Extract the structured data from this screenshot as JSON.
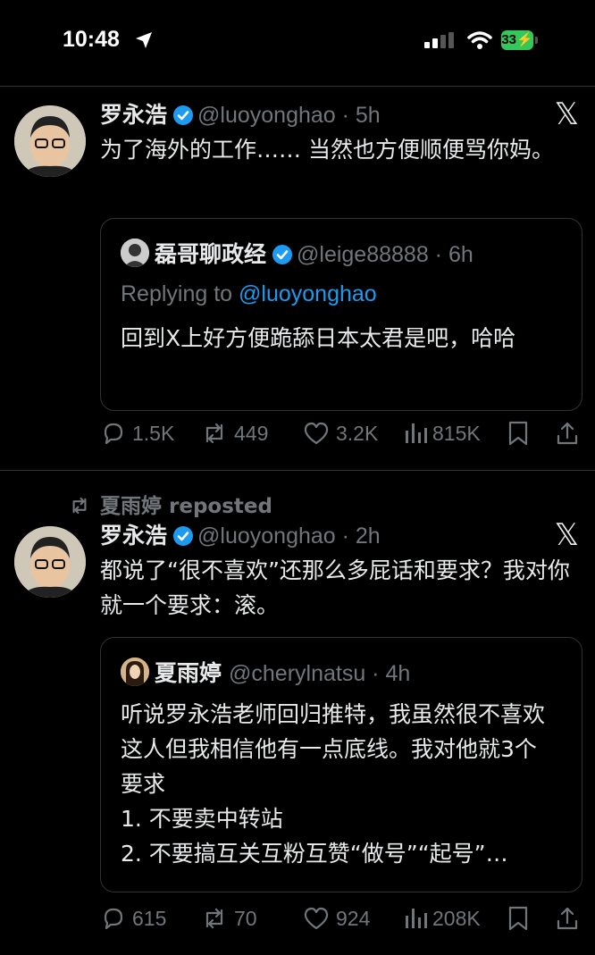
{
  "status_bar": {
    "time": "10:48",
    "battery": "33"
  },
  "tweets": [
    {
      "author": "罗永浩",
      "handle": "@luoyonghao · 5h",
      "text": "为了海外的工作…… 当然也方便顺便骂你妈。",
      "quote": {
        "author": "磊哥聊政经",
        "handle": "@leige88888 · 6h",
        "replying_prefix": "Replying to ",
        "replying_to": "@luoyonghao",
        "text": "回到X上好方便跪舔日本太君是吧，哈哈"
      },
      "stats": {
        "replies": "1.5K",
        "reposts": "449",
        "likes": "3.2K",
        "views": "815K"
      }
    },
    {
      "reposted_by": "夏雨婷 reposted",
      "author": "罗永浩",
      "handle": "@luoyonghao · 2h",
      "text": "都说了“很不喜欢”还那么多屁话和要求？我对你就一个要求：滚。",
      "quote": {
        "author": "夏雨婷",
        "handle": "@cherylnatsu · 4h",
        "lines": [
          "听说罗永浩老师回归推特，我虽然很不喜欢这人但我相信他有一点底线。我对他就3个要求",
          "1. 不要卖中转站",
          "2. 不要搞互关互粉互赞“做号”“起号”…"
        ]
      },
      "stats": {
        "replies": "615",
        "reposts": "70",
        "likes": "924",
        "views": "208K"
      }
    }
  ],
  "colors": {
    "background": "#000000",
    "text": "#e7e9ea",
    "muted": "#71767b",
    "link": "#1d9bf0",
    "verified": "#1d9bf0",
    "divider": "#2f3336"
  },
  "icons": [
    "location-arrow-icon",
    "cellular-signal-icon",
    "wifi-icon",
    "battery-icon",
    "verified-badge-icon",
    "x-logo-icon",
    "reply-icon",
    "repost-icon",
    "like-icon",
    "views-icon",
    "bookmark-icon",
    "share-icon"
  ]
}
